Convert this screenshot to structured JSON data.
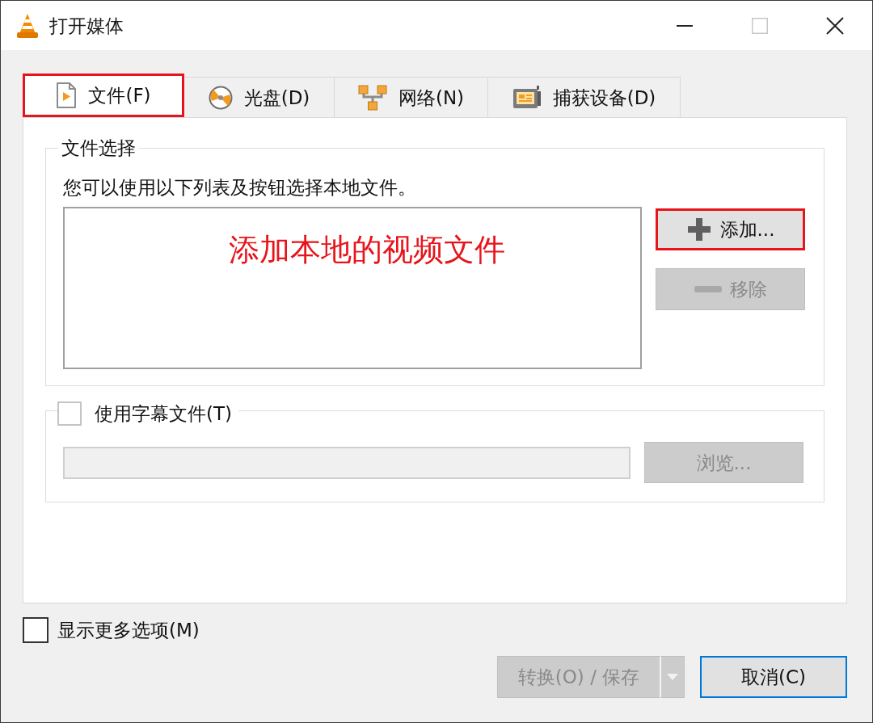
{
  "window": {
    "title": "打开媒体",
    "maximize_disabled": true
  },
  "tabs": [
    {
      "label": "文件(F)",
      "selected": true,
      "highlighted": true
    },
    {
      "label": "光盘(D)",
      "selected": false,
      "highlighted": false
    },
    {
      "label": "网络(N)",
      "selected": false,
      "highlighted": false
    },
    {
      "label": "捕获设备(D)",
      "selected": false,
      "highlighted": false
    }
  ],
  "file_selection": {
    "title": "文件选择",
    "description": "您可以使用以下列表及按钮选择本地文件。",
    "annotation": "添加本地的视频文件",
    "buttons": [
      {
        "label": "添加...",
        "disabled": false,
        "highlighted": true
      },
      {
        "label": "移除",
        "disabled": true,
        "highlighted": false
      }
    ]
  },
  "subtitle": {
    "label": "使用字幕文件(T)",
    "checked": false,
    "browse_button": {
      "label": "浏览...",
      "disabled": true
    }
  },
  "show_more": {
    "label": "显示更多选项(M)",
    "checked": false
  },
  "footer_buttons": [
    {
      "kind": "split",
      "label": "转换(O) / 保存",
      "disabled": true
    },
    {
      "kind": "default",
      "label": "取消(C)",
      "disabled": false
    }
  ]
}
